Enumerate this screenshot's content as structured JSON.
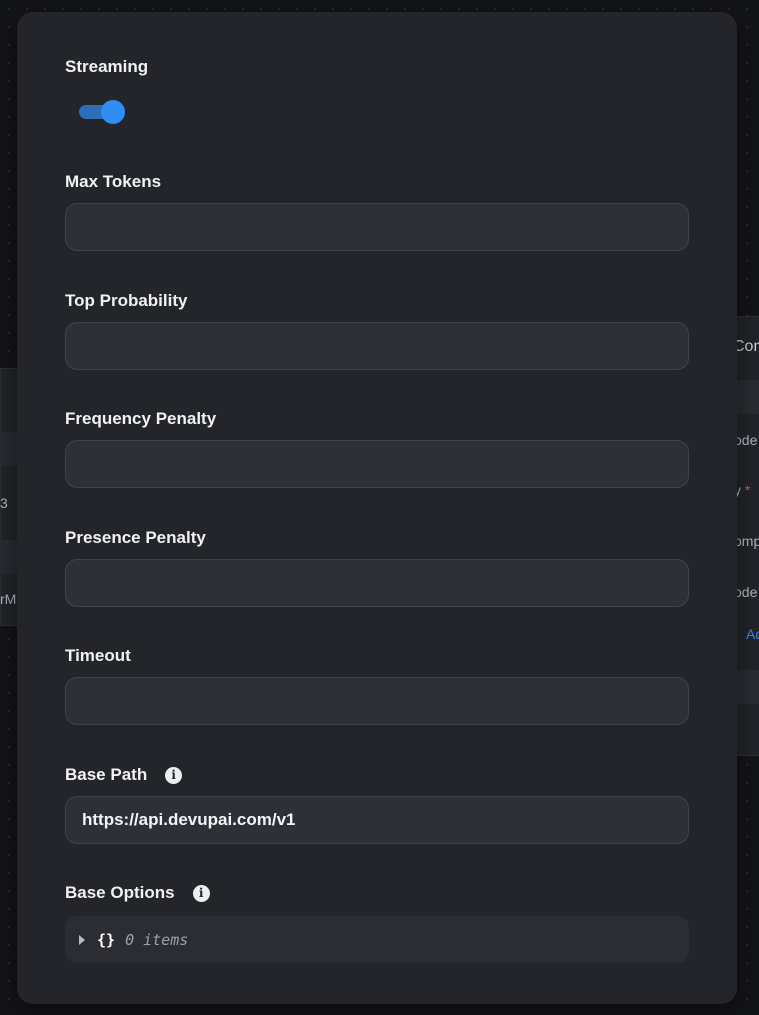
{
  "background": {
    "left_node_text": "rM",
    "left_node_text2": "3",
    "right_node_title": "Con",
    "right_node_rows": [
      "ode",
      "y",
      "omp",
      "ode",
      "Ad"
    ]
  },
  "dialog": {
    "streaming": {
      "label": "Streaming",
      "enabled": true
    },
    "max_tokens": {
      "label": "Max Tokens",
      "value": ""
    },
    "top_probability": {
      "label": "Top Probability",
      "value": ""
    },
    "frequency_penalty": {
      "label": "Frequency Penalty",
      "value": ""
    },
    "presence_penalty": {
      "label": "Presence Penalty",
      "value": ""
    },
    "timeout": {
      "label": "Timeout",
      "value": ""
    },
    "base_path": {
      "label": "Base Path",
      "value": "https://api.devupai.com/v1",
      "info_icon": "info-icon"
    },
    "base_options": {
      "label": "Base Options",
      "braces": "{}",
      "count_text": "0 items",
      "info_icon": "info-icon"
    }
  },
  "colors": {
    "accent": "#2f8ef4",
    "dialog_bg": "#23252b",
    "input_bg": "#2e3037"
  }
}
